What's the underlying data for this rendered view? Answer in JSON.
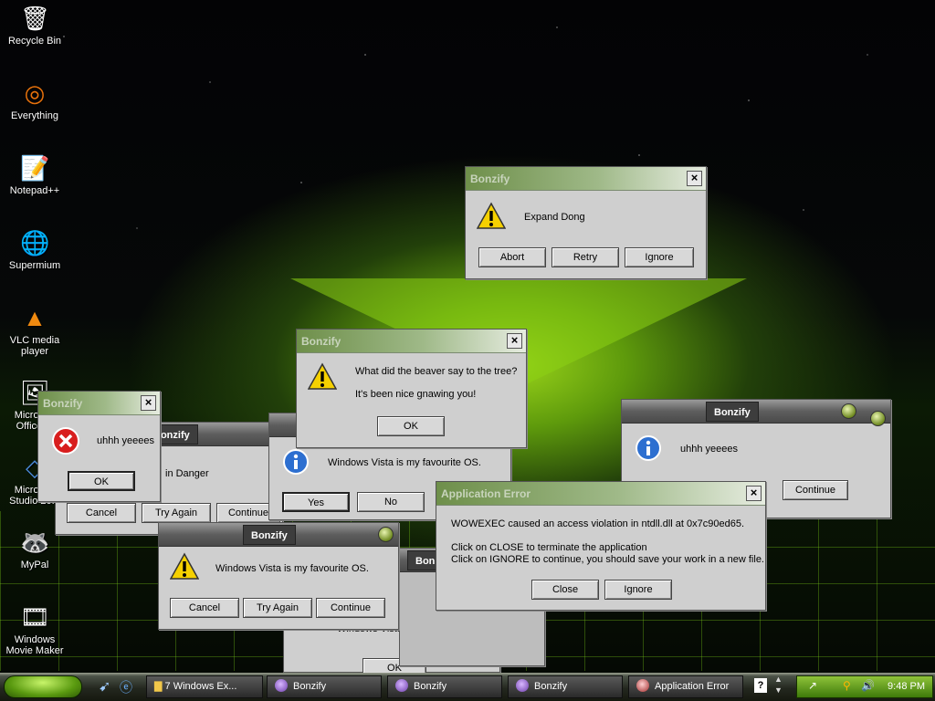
{
  "desktop": {
    "icons": [
      {
        "label": "Recycle Bin",
        "glyph": "🗑"
      },
      {
        "label": "Everything",
        "glyph": "◎"
      },
      {
        "label": "Notepad++",
        "glyph": "📝"
      },
      {
        "label": "Supermium",
        "glyph": "🌐"
      },
      {
        "label": "VLC media player",
        "glyph": "▲"
      },
      {
        "label": "Microsoft Office ...",
        "glyph": "🖼"
      },
      {
        "label": "Microsoft Studio 20...",
        "glyph": "◇"
      },
      {
        "label": "MyPal",
        "glyph": "🦝"
      },
      {
        "label": "Windows Movie Maker",
        "glyph": "🎞"
      }
    ]
  },
  "dialogs": {
    "expand": {
      "title": "Bonzify",
      "message": "Expand Dong",
      "buttons": [
        "Abort",
        "Retry",
        "Ignore"
      ]
    },
    "beaver": {
      "title": "Bonzify",
      "message1": "What did the beaver say to the tree?",
      "message2": "It's been nice gnawing you!",
      "ok": "OK"
    },
    "uhhh_left": {
      "title": "Bonzify",
      "message": "uhhh yeeees",
      "ok": "OK"
    },
    "danger": {
      "title": "Bonzify",
      "message": "in Danger",
      "buttons": [
        "Cancel",
        "Try Again",
        "Continue"
      ]
    },
    "vista_yesno": {
      "message": "Windows Vista is my favourite OS.",
      "buttons": [
        "Yes",
        "No"
      ]
    },
    "uhhh_right": {
      "title": "Bonzify",
      "message": "uhhh yeeees",
      "continue": "Continue"
    },
    "app_error": {
      "title": "Application Error",
      "line1": "WOWEXEC caused an access violation in ntdll.dll at 0x7c90ed65.",
      "line2": "Click on CLOSE to terminate the application",
      "line3": "Click on IGNORE to continue, you should save your work in a new file.",
      "close": "Close",
      "ignore": "Ignore"
    },
    "vista_main": {
      "title": "Bonzify",
      "message": "Windows Vista is my favourite OS.",
      "buttons": [
        "Cancel",
        "Try Again",
        "Continue"
      ]
    },
    "vista_bottom": {
      "message": "Windows Vista is my favourite OS.",
      "ok": "OK",
      "title_fragment": "Bon"
    }
  },
  "taskbar": {
    "items": [
      {
        "label": "7 Windows Ex..."
      },
      {
        "label": "Bonzify"
      },
      {
        "label": "Bonzify"
      },
      {
        "label": "Bonzify"
      },
      {
        "label": "Application Error"
      }
    ],
    "clock": "9:48 PM"
  },
  "colors": {
    "accent": "#7ab51d",
    "dialog_bg": "#cfcfcf"
  }
}
